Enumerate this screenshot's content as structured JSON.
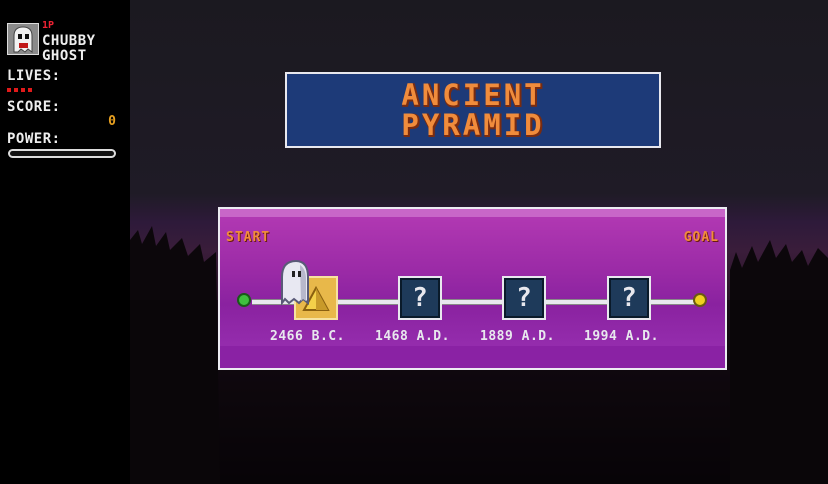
{
  "hud": {
    "player_tag": "1P",
    "player_name_line1": "CHUBBY",
    "player_name_line2": "GHOST",
    "lives_label": "LIVES:",
    "lives_count": 4,
    "score_label": "SCORE:",
    "score_value": "0",
    "power_label": "POWER:",
    "power_level": 0
  },
  "title": {
    "line1": "ANCIENT",
    "line2": "PYRAMID"
  },
  "timeline": {
    "start_label": "START",
    "goal_label": "GOAL",
    "stages": [
      {
        "year": "2466 B.C.",
        "state": "current",
        "icon": "pyramid-icon"
      },
      {
        "year": "1468 A.D.",
        "state": "locked",
        "icon": "question-mark-icon",
        "symbol": "?"
      },
      {
        "year": "1889 A.D.",
        "state": "locked",
        "icon": "question-mark-icon",
        "symbol": "?"
      },
      {
        "year": "1994 A.D.",
        "state": "locked",
        "icon": "question-mark-icon",
        "symbol": "?"
      }
    ]
  },
  "colors": {
    "title_bg": "#1d3a78",
    "title_text": "#f08c3c",
    "panel_purple": "#9a2aa6",
    "start_node": "#3fbf3f",
    "goal_node": "#f0d020",
    "lives_pip": "#e01a1a",
    "score_value": "#e8a020"
  }
}
